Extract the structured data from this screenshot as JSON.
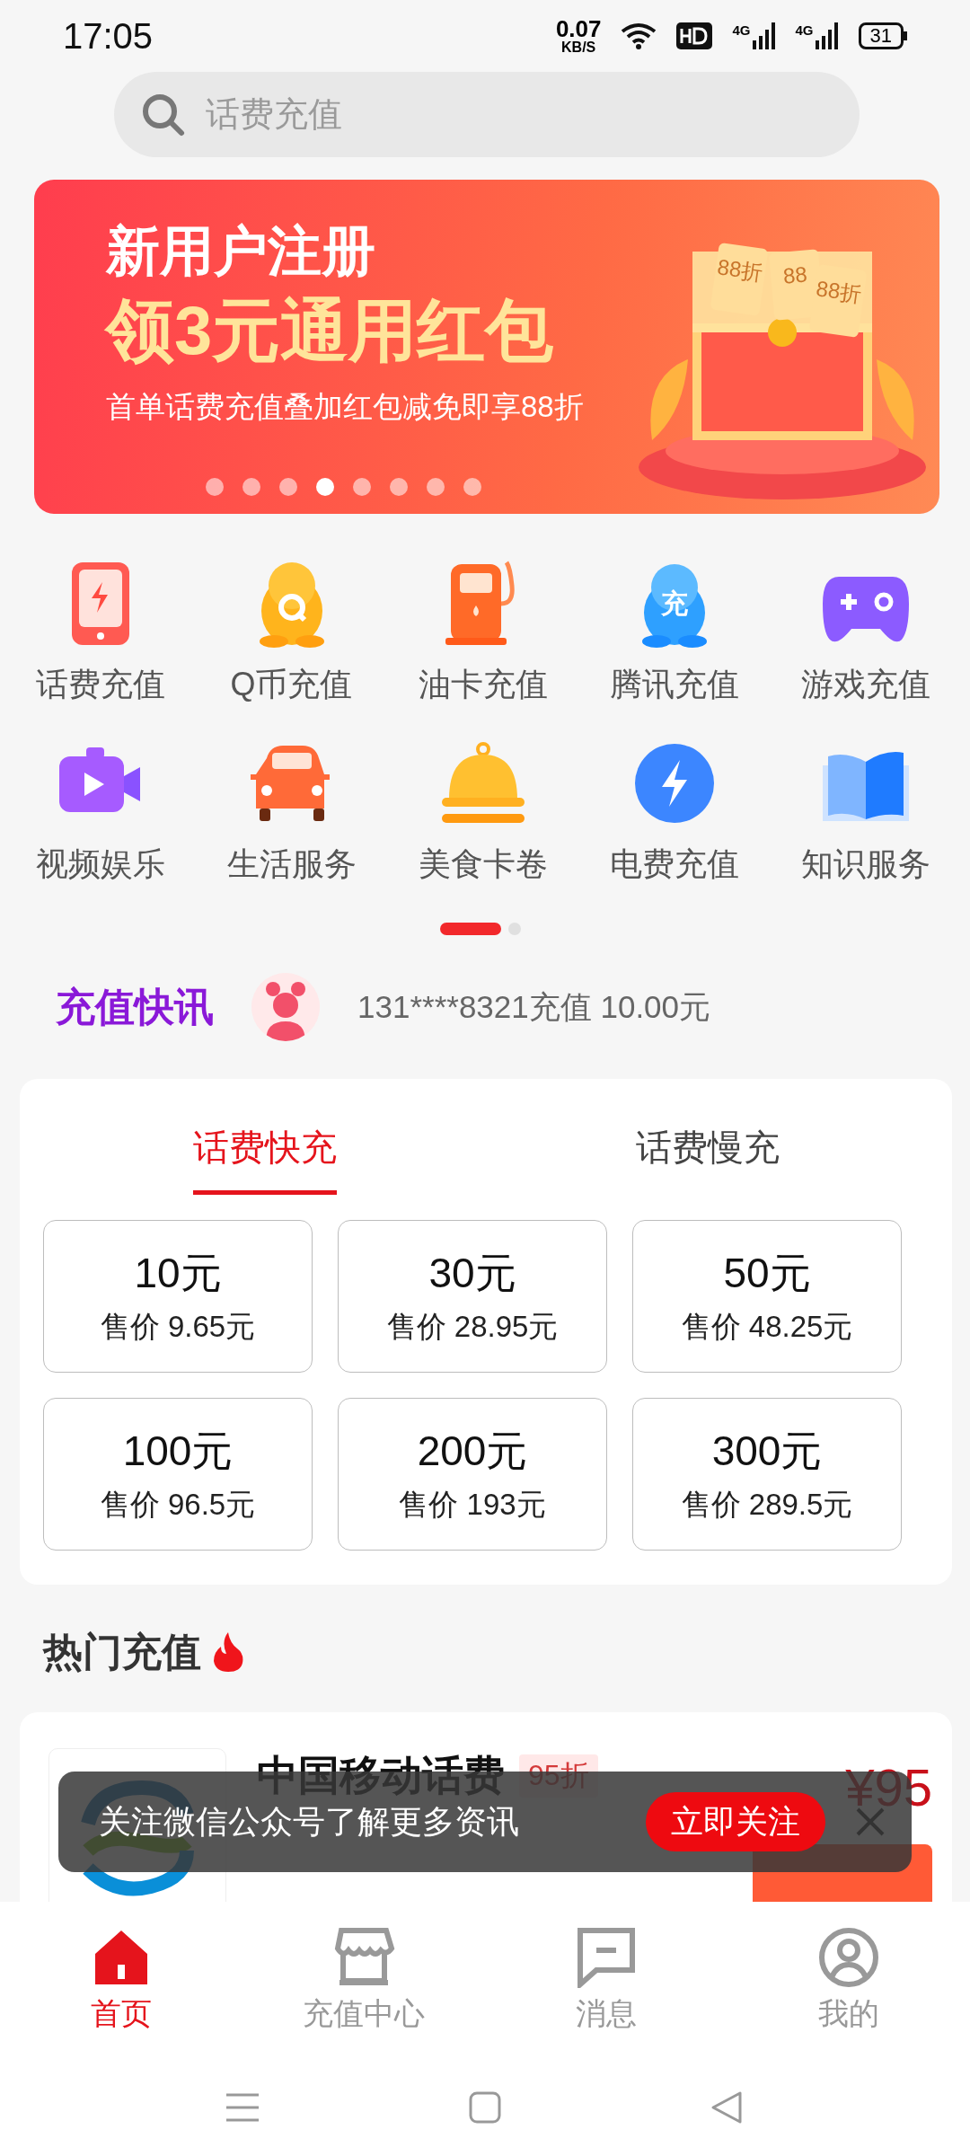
{
  "status_bar": {
    "time": "17:05",
    "net_speed": "0.07",
    "net_speed_unit": "KB/S",
    "signals": [
      {
        "label": "4G"
      },
      {
        "label": "4G"
      }
    ],
    "battery": "31"
  },
  "search": {
    "placeholder": "话费充值"
  },
  "banner": {
    "title": "新用户注册",
    "headline": "领3元通用红包",
    "subtitle": "首单话费充值叠加红包减免即享88折",
    "tags": [
      "88折",
      "88",
      "88折"
    ],
    "dots": [
      {
        "selected": false
      },
      {
        "selected": false
      },
      {
        "selected": false
      },
      {
        "selected": true
      },
      {
        "selected": false
      },
      {
        "selected": false
      },
      {
        "selected": false
      },
      {
        "selected": false
      }
    ]
  },
  "categories": [
    {
      "kind": "phone",
      "label": "话费充值"
    },
    {
      "kind": "qcoin",
      "label": "Q币充值"
    },
    {
      "kind": "fuel",
      "label": "油卡充值"
    },
    {
      "kind": "tencent",
      "label": "腾讯充值",
      "badge": "充"
    },
    {
      "kind": "game",
      "label": "游戏充值"
    },
    {
      "kind": "video",
      "label": "视频娱乐"
    },
    {
      "kind": "car",
      "label": "生活服务"
    },
    {
      "kind": "food",
      "label": "美食卡卷"
    },
    {
      "kind": "power",
      "label": "电费充值"
    },
    {
      "kind": "book",
      "label": "知识服务"
    }
  ],
  "category_pages": [
    {
      "selected": true
    },
    {
      "selected": false
    }
  ],
  "news": {
    "title": "充值快讯",
    "text": "131****8321充值 10.00元"
  },
  "recharge": {
    "tabs": [
      {
        "label": "话费快充",
        "selected": true
      },
      {
        "label": "话费慢充",
        "selected": false
      }
    ],
    "amounts": [
      {
        "face": "10元",
        "price": "售价 9.65元"
      },
      {
        "face": "30元",
        "price": "售价 28.95元"
      },
      {
        "face": "50元",
        "price": "售价 48.25元"
      },
      {
        "face": "100元",
        "price": "售价 96.5元"
      },
      {
        "face": "200元",
        "price": "售价 193元"
      },
      {
        "face": "300元",
        "price": "售价 289.5元"
      }
    ]
  },
  "hot": {
    "title": "热门充值",
    "products": [
      {
        "name": "中国移动话费",
        "discount": "95折",
        "price": "¥95"
      }
    ]
  },
  "toast": {
    "text": "关注微信公众号了解更多资讯",
    "button": "立即关注"
  },
  "tab_bar": [
    {
      "kind": "home",
      "label": "首页",
      "selected": true
    },
    {
      "kind": "store",
      "label": "充值中心",
      "selected": false
    },
    {
      "kind": "message",
      "label": "消息",
      "selected": false
    },
    {
      "kind": "profile",
      "label": "我的",
      "selected": false
    }
  ]
}
